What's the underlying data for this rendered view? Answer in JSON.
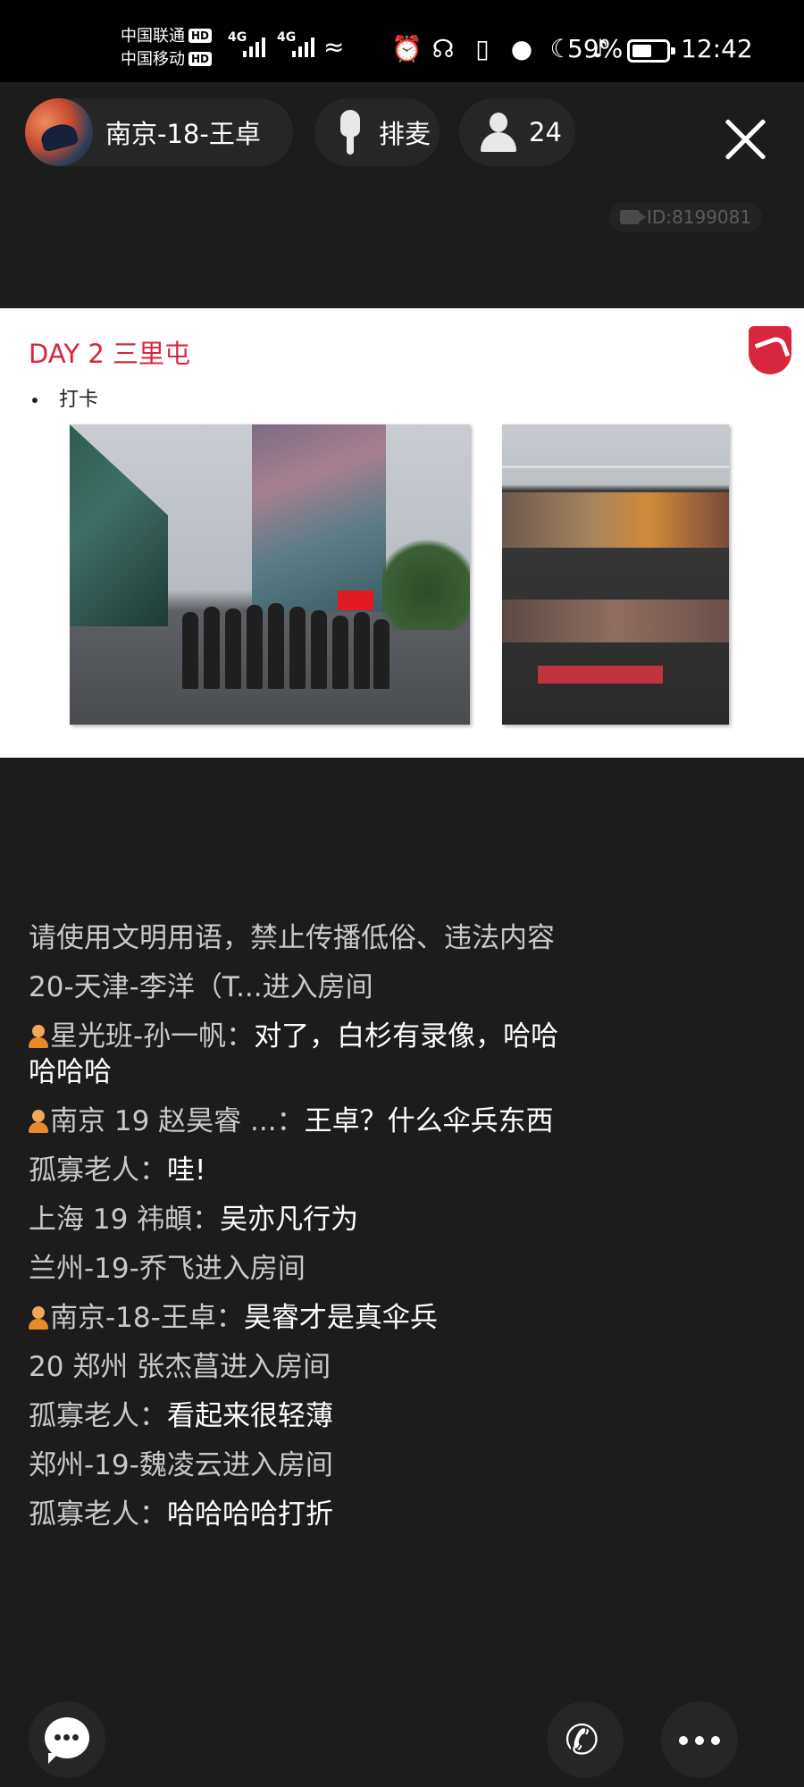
{
  "status_bar": {
    "carrier1": "中国联通",
    "carrier2": "中国移动",
    "hd": "HD",
    "net1": "4G",
    "net2": "4G",
    "battery_percent": "59%",
    "battery_level": 0.59,
    "time": "12:42",
    "icons": [
      "wifi-icon",
      "alarm-icon",
      "headphones-icon",
      "vibrate-icon",
      "location-icon",
      "moon-icon",
      "mute-icon"
    ]
  },
  "header": {
    "host_name": "南京-18-王卓",
    "mic_queue_label": "排麦",
    "audience_count": "24",
    "room_id": "ID:8199081"
  },
  "slide": {
    "title": "DAY 2 三里屯",
    "bullet": "打卡"
  },
  "chat": {
    "notice": "请使用文明用语，禁止传播低俗、违法内容",
    "messages": [
      {
        "type": "system",
        "text": "20-天津-李洋（T...进入房间"
      },
      {
        "type": "user",
        "badge": true,
        "name": "星光班-孙一帆：",
        "text": "对了，白杉有录像，哈哈哈哈哈"
      },
      {
        "type": "user",
        "badge": true,
        "name": "南京 19 赵昊睿 ...：",
        "text": "王卓？什么伞兵东西"
      },
      {
        "type": "user",
        "badge": false,
        "name": "孤寡老人：",
        "text": "哇!"
      },
      {
        "type": "user",
        "badge": false,
        "name": "上海 19 祎頔：",
        "text": "吴亦凡行为"
      },
      {
        "type": "system",
        "text": "兰州-19-乔飞进入房间"
      },
      {
        "type": "user",
        "badge": true,
        "name": "南京-18-王卓：",
        "text": "昊睿才是真伞兵"
      },
      {
        "type": "system",
        "text": "20 郑州 张杰菖进入房间"
      },
      {
        "type": "user",
        "badge": false,
        "name": "孤寡老人：",
        "text": "看起来很轻薄"
      },
      {
        "type": "system",
        "text": "郑州-19-魏凌云进入房间"
      },
      {
        "type": "user",
        "badge": false,
        "name": "孤寡老人：",
        "text": "哈哈哈哈打折"
      }
    ]
  },
  "bottom_bar": {
    "icons": [
      "chat-bubble-icon",
      "phone-call-icon",
      "more-dots-icon"
    ]
  },
  "colors": {
    "background": "#1c1c1c",
    "slide_accent": "#d7263d",
    "chat_name": "#c9c9c9"
  }
}
